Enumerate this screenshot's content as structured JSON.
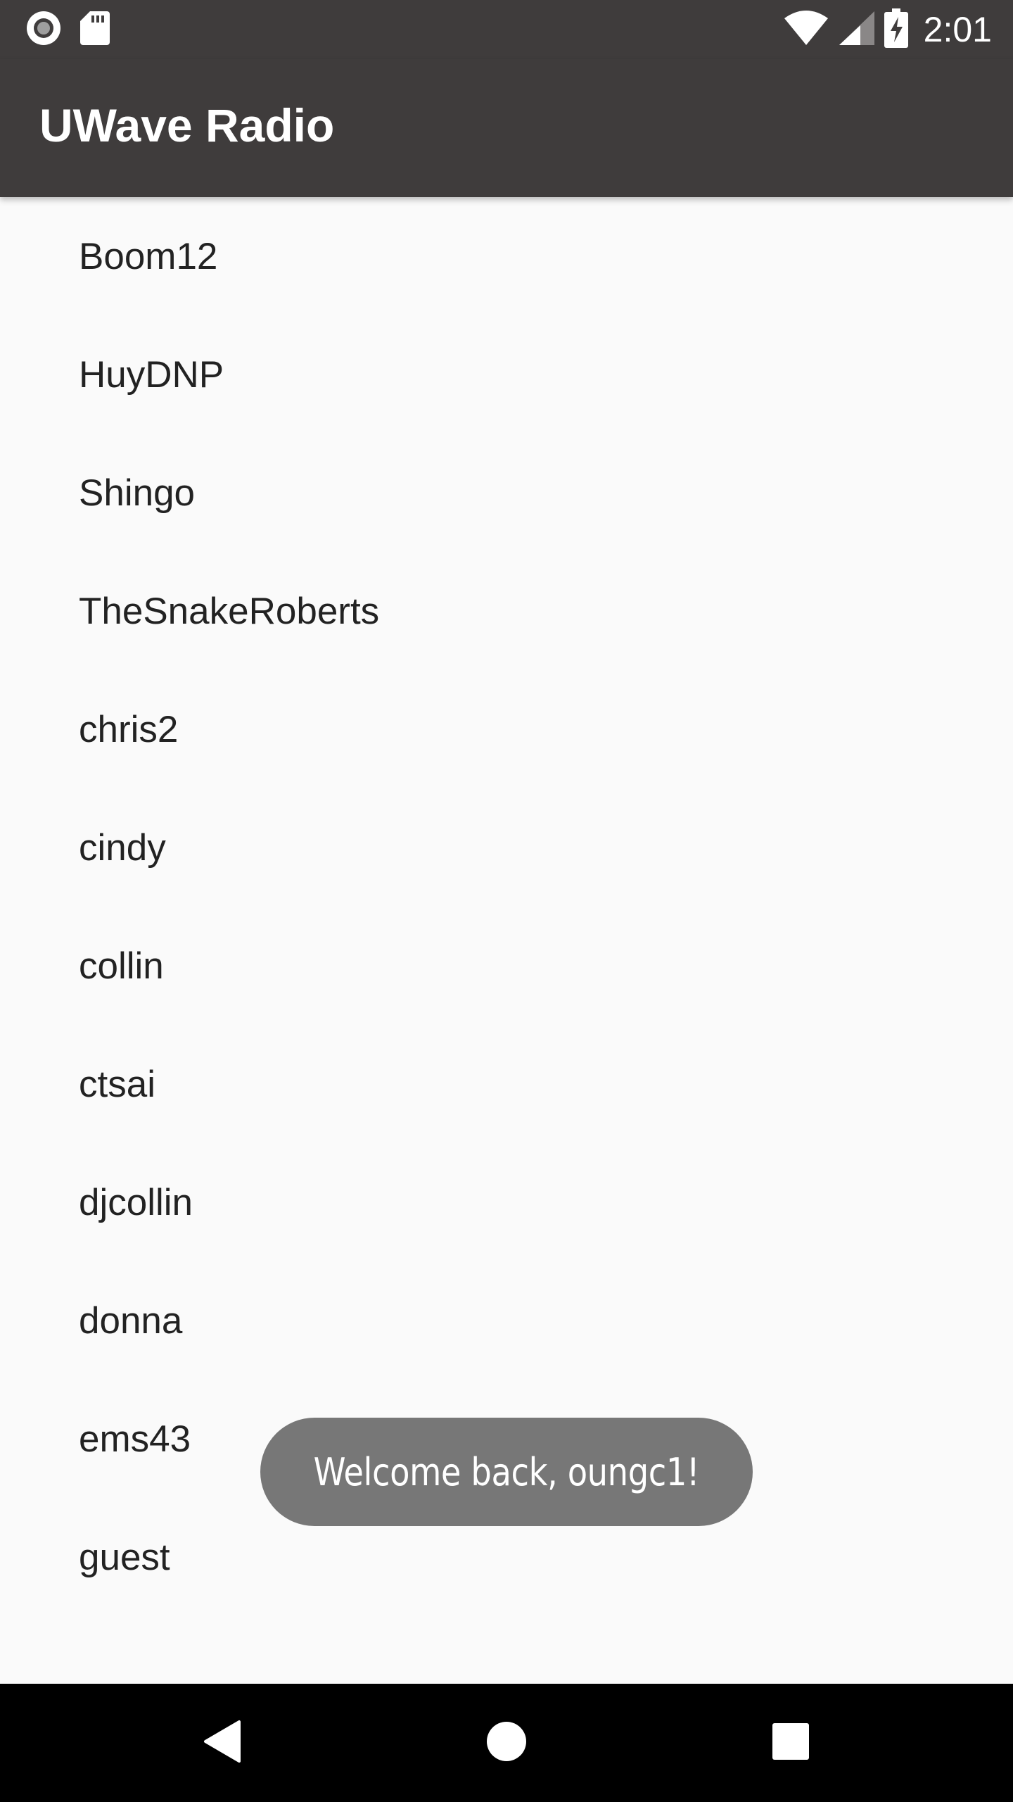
{
  "status_bar": {
    "time": "2:01",
    "icons": [
      "record-icon",
      "sd-card-icon",
      "wifi-icon",
      "cell-signal-icon",
      "battery-charging-icon"
    ]
  },
  "app_bar": {
    "title": "UWave Radio"
  },
  "list": {
    "items": [
      "Boom12",
      "HuyDNP",
      "Shingo",
      "TheSnakeRoberts",
      "chris2",
      "cindy",
      "collin",
      "ctsai",
      "djcollin",
      "donna",
      "ems43",
      "guest"
    ]
  },
  "toast": {
    "message": "Welcome back, oungc1!"
  },
  "nav_bar": {
    "buttons": [
      "back-icon",
      "home-icon",
      "recents-icon"
    ]
  },
  "colors": {
    "app_bar": "#3f3c3c",
    "background": "#fafafa",
    "toast": "#777777",
    "nav_bar": "#000000"
  }
}
